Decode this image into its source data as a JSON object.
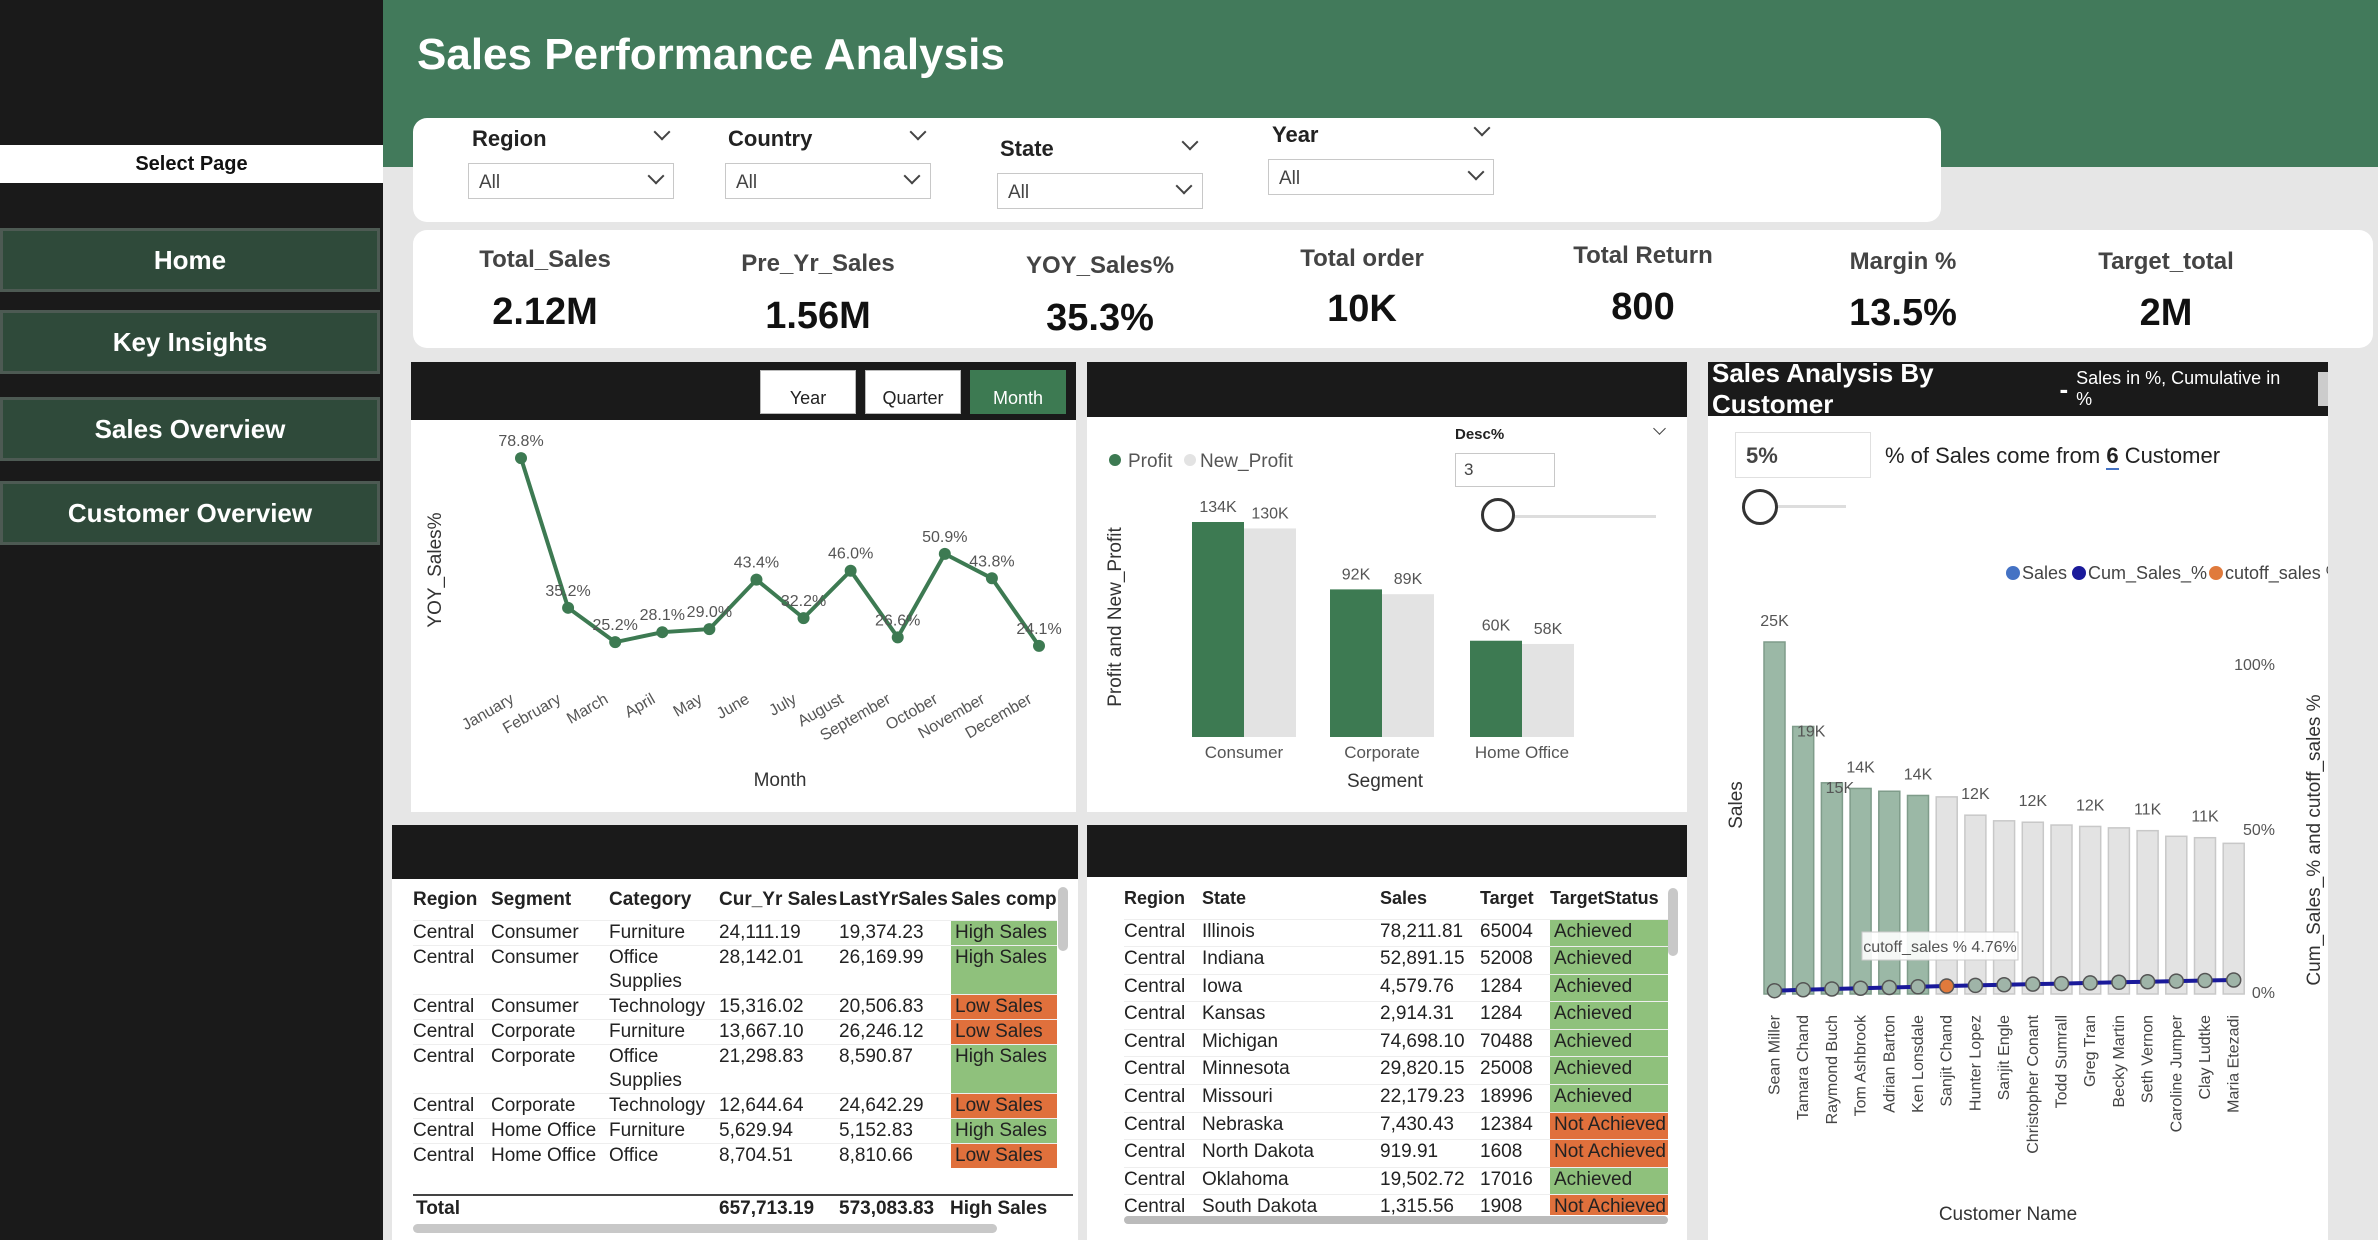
{
  "page_title": "Sales Performance Analysis",
  "nav": {
    "select_page": "Select Page",
    "items": [
      {
        "label": "Home"
      },
      {
        "label": "Key Insights"
      },
      {
        "label": "Sales Overview"
      },
      {
        "label": "Customer Overview"
      }
    ]
  },
  "filters": [
    {
      "label": "Region",
      "value": "All"
    },
    {
      "label": "Country",
      "value": "All"
    },
    {
      "label": "State",
      "value": "All"
    },
    {
      "label": "Year",
      "value": "All"
    }
  ],
  "kpis": [
    {
      "label": "Total_Sales",
      "value": "2.12M"
    },
    {
      "label": "Pre_Yr_Sales",
      "value": "1.56M"
    },
    {
      "label": "YOY_Sales%",
      "value": "35.3%"
    },
    {
      "label": "Total order",
      "value": "10K"
    },
    {
      "label": "Total Return",
      "value": "800"
    },
    {
      "label": "Margin %",
      "value": "13.5%"
    },
    {
      "label": "Target_total",
      "value": "2M"
    }
  ],
  "yoy_chart": {
    "toggles": [
      "Year",
      "Quarter",
      "Month"
    ],
    "active_toggle": "Month",
    "accent": "#3d7a52"
  },
  "segment_chart": {
    "slicer_label": "Desc%",
    "slicer_value": "3",
    "colors": {
      "profit": "#3d7a52",
      "new_profit": "#e3e3e3"
    }
  },
  "customer_chart": {
    "title": "Sales Analysis By Customer",
    "subtitle": "Sales in %, Cumulative in %",
    "pct_input": "5%",
    "summary_prefix": "% of Sales come from",
    "summary_count": "6",
    "summary_suffix": "Customer",
    "tooltip": "cutoff_sales % 4.76%",
    "colors": {
      "top": "#9bb8a6",
      "rest": "#e3e3e3",
      "line": "#1a1a9a",
      "cutoff": "#e07a3c",
      "legend_sales": "#4472c4"
    }
  },
  "chart_data": [
    {
      "type": "line",
      "title": "",
      "xlabel": "Month",
      "ylabel": "YOY_Sales%",
      "categories": [
        "January",
        "February",
        "March",
        "April",
        "May",
        "June",
        "July",
        "August",
        "September",
        "October",
        "November",
        "December"
      ],
      "values": [
        78.8,
        35.2,
        25.2,
        28.1,
        29.0,
        43.4,
        32.2,
        46.0,
        26.6,
        50.9,
        43.8,
        24.1
      ],
      "labels": [
        "78.8%",
        "35.2%",
        "25.2%",
        "28.1%",
        "29.0%",
        "43.4%",
        "32.2%",
        "46.0%",
        "26.6%",
        "50.9%",
        "43.8%",
        "24.1%"
      ],
      "grid": false
    },
    {
      "type": "bar",
      "title": "",
      "xlabel": "Segment",
      "ylabel": "Profit and New_Profit",
      "categories": [
        "Consumer",
        "Corporate",
        "Home Office"
      ],
      "series": [
        {
          "name": "Profit",
          "values": [
            134,
            92,
            60
          ],
          "labels": [
            "134K",
            "92K",
            "60K"
          ]
        },
        {
          "name": "New_Profit",
          "values": [
            130,
            89,
            58
          ],
          "labels": [
            "130K",
            "89K",
            "58K"
          ]
        }
      ],
      "legend": "top-left"
    },
    {
      "type": "bar",
      "title": "",
      "xlabel": "Customer Name",
      "ylabel": "Sales",
      "y2label": "Cum_Sales_% and cutoff_sales %",
      "y2ticks": [
        "0%",
        "50%",
        "100%"
      ],
      "categories": [
        "Sean Miller",
        "Tamara Chand",
        "Raymond Buch",
        "Tom Ashbrook",
        "Adrian Barton",
        "Ken Lonsdale",
        "Sanjit Chand",
        "Hunter Lopez",
        "Sanjit Engle",
        "Christopher Conant",
        "Todd Sumrall",
        "Greg Tran",
        "Becky Martin",
        "Seth Vernon",
        "Caroline Jumper",
        "Clay Ludtke",
        "Maria Etezadi"
      ],
      "series": [
        {
          "name": "Sales",
          "values": [
            25,
            19,
            15,
            14.6,
            14.4,
            14.1,
            14,
            12.7,
            12.3,
            12.2,
            12,
            11.9,
            11.8,
            11.6,
            11.2,
            11.1,
            10.7
          ]
        },
        {
          "name": "Cum_Sales_%",
          "values": [
            1.2,
            2.1,
            2.8,
            3.5,
            4.2,
            4.8,
            5.5,
            6.1,
            6.7,
            7.3,
            7.8,
            8.4,
            9.0,
            9.5,
            10.1,
            10.6,
            11.1
          ]
        },
        {
          "name": "cutoff_sales %",
          "values": [
            4.76
          ]
        }
      ],
      "bar_labels": [
        "25K",
        "19K",
        "15K",
        "14K",
        "",
        "14K",
        "",
        "12K",
        "",
        "12K",
        "",
        "12K",
        "",
        "11K",
        "",
        "11K",
        ""
      ],
      "highlighted_count": 6,
      "legend": "top-right"
    }
  ],
  "table1": {
    "headers": [
      "Region",
      "Segment",
      "Category",
      "Cur_Yr Sales",
      "LastYrSales",
      "Sales compa"
    ],
    "rows": [
      {
        "region": "Central",
        "segment": "Consumer",
        "category": "Furniture",
        "cur": "24,111.19",
        "last": "19,374.23",
        "status": "High Sales",
        "good": true
      },
      {
        "region": "Central",
        "segment": "Consumer",
        "category": "Office Supplies",
        "cur": "28,142.01",
        "last": "26,169.99",
        "status": "High Sales",
        "good": true
      },
      {
        "region": "Central",
        "segment": "Consumer",
        "category": "Technology",
        "cur": "15,316.02",
        "last": "20,506.83",
        "status": "Low Sales",
        "good": false
      },
      {
        "region": "Central",
        "segment": "Corporate",
        "category": "Furniture",
        "cur": "13,667.10",
        "last": "26,246.12",
        "status": "Low Sales",
        "good": false
      },
      {
        "region": "Central",
        "segment": "Corporate",
        "category": "Office Supplies",
        "cur": "21,298.83",
        "last": "8,590.87",
        "status": "High Sales",
        "good": true
      },
      {
        "region": "Central",
        "segment": "Corporate",
        "category": "Technology",
        "cur": "12,644.64",
        "last": "24,642.29",
        "status": "Low Sales",
        "good": false
      },
      {
        "region": "Central",
        "segment": "Home Office",
        "category": "Furniture",
        "cur": "5,629.94",
        "last": "5,152.83",
        "status": "High Sales",
        "good": true
      },
      {
        "region": "Central",
        "segment": "Home Office",
        "category": "Office",
        "cur": "8,704.51",
        "last": "8,810.66",
        "status": "Low Sales",
        "good": false
      }
    ],
    "total": {
      "label": "Total",
      "cur": "657,713.19",
      "last": "573,083.83",
      "status": "High Sales"
    }
  },
  "table2": {
    "headers": [
      "Region",
      "State",
      "Sales",
      "Target",
      "TargetStatus"
    ],
    "rows": [
      {
        "region": "Central",
        "state": "Illinois",
        "sales": "78,211.81",
        "target": "65004",
        "status": "Achieved",
        "good": true
      },
      {
        "region": "Central",
        "state": "Indiana",
        "sales": "52,891.15",
        "target": "52008",
        "status": "Achieved",
        "good": true
      },
      {
        "region": "Central",
        "state": "Iowa",
        "sales": "4,579.76",
        "target": "1284",
        "status": "Achieved",
        "good": true
      },
      {
        "region": "Central",
        "state": "Kansas",
        "sales": "2,914.31",
        "target": "1284",
        "status": "Achieved",
        "good": true
      },
      {
        "region": "Central",
        "state": "Michigan",
        "sales": "74,698.10",
        "target": "70488",
        "status": "Achieved",
        "good": true
      },
      {
        "region": "Central",
        "state": "Minnesota",
        "sales": "29,820.15",
        "target": "25008",
        "status": "Achieved",
        "good": true
      },
      {
        "region": "Central",
        "state": "Missouri",
        "sales": "22,179.23",
        "target": "18996",
        "status": "Achieved",
        "good": true
      },
      {
        "region": "Central",
        "state": "Nebraska",
        "sales": "7,430.43",
        "target": "12384",
        "status": "Not Achieved",
        "good": false
      },
      {
        "region": "Central",
        "state": "North Dakota",
        "sales": "919.91",
        "target": "1608",
        "status": "Not Achieved",
        "good": false
      },
      {
        "region": "Central",
        "state": "Oklahoma",
        "sales": "19,502.72",
        "target": "17016",
        "status": "Achieved",
        "good": true
      },
      {
        "region": "Central",
        "state": "South Dakota",
        "sales": "1,315.56",
        "target": "1908",
        "status": "Not Achieved",
        "good": false
      }
    ]
  }
}
